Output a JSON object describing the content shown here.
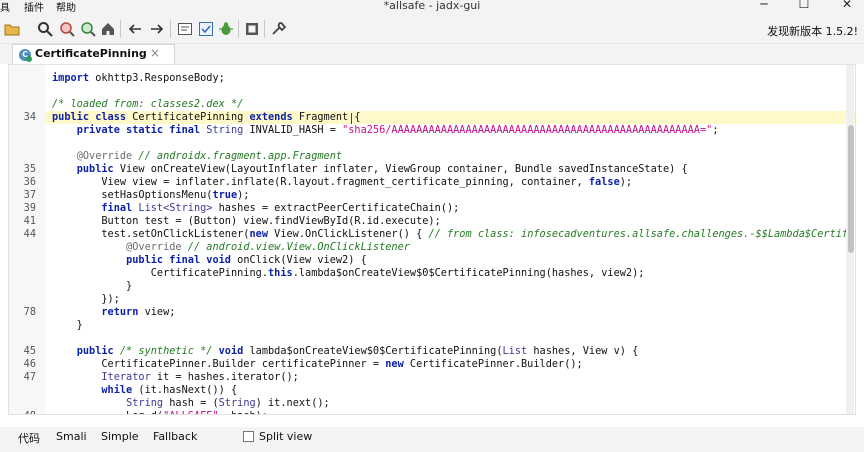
{
  "window": {
    "title": "*allsafe - jadx-gui",
    "menu": [
      "具",
      "插件",
      "帮助"
    ],
    "controls": [
      "─",
      "☐",
      "✕"
    ]
  },
  "toolbar": {
    "icons": [
      "folder-icon",
      "search-icon",
      "search-usage-icon",
      "find-icon",
      "home-icon",
      "back-icon",
      "forward-icon",
      "sync-tree-icon",
      "decompile-icon",
      "debug-icon",
      "log-icon",
      "settings-icon"
    ],
    "update_label": "发现新版本 1.5.2!"
  },
  "tab": {
    "label": "CertificatePinning",
    "icon_letter": "C",
    "close": "×"
  },
  "code_lines": [
    {
      "num": "",
      "segs": [
        {
          "t": "kw",
          "v": "import"
        },
        {
          "t": "tx",
          "v": " okhttp3.ResponseBody;"
        }
      ]
    },
    {
      "num": "",
      "segs": []
    },
    {
      "num": "",
      "segs": [
        {
          "t": "cm",
          "v": "/* loaded from: classes2.dex */"
        }
      ]
    },
    {
      "num": "34",
      "segs": [
        {
          "t": "kw",
          "v": "public class"
        },
        {
          "t": "tx",
          "v": " CertificatePinning "
        },
        {
          "t": "kw",
          "v": "extends"
        },
        {
          "t": "tx",
          "v": " Fragment {"
        }
      ]
    },
    {
      "num": "",
      "segs": [
        {
          "t": "tx",
          "v": "    "
        },
        {
          "t": "kw",
          "v": "private static final"
        },
        {
          "t": "tx",
          "v": " "
        },
        {
          "t": "ty",
          "v": "String"
        },
        {
          "t": "tx",
          "v": " INVALID_HASH = "
        },
        {
          "t": "st",
          "v": "\"sha256/AAAAAAAAAAAAAAAAAAAAAAAAAAAAAAAAAAAAAAAAAAAAAAAAAA=\""
        },
        {
          "t": "tx",
          "v": ";"
        }
      ]
    },
    {
      "num": "",
      "segs": []
    },
    {
      "num": "",
      "segs": [
        {
          "t": "tx",
          "v": "    "
        },
        {
          "t": "an",
          "v": "@Override"
        },
        {
          "t": "cm",
          "v": " // androidx.fragment.app.Fragment"
        }
      ]
    },
    {
      "num": "35",
      "segs": [
        {
          "t": "tx",
          "v": "    "
        },
        {
          "t": "kw",
          "v": "public"
        },
        {
          "t": "tx",
          "v": " View onCreateView(LayoutInflater inflater, ViewGroup container, Bundle savedInstanceState) {"
        }
      ]
    },
    {
      "num": "36",
      "segs": [
        {
          "t": "tx",
          "v": "        View view = inflater.inflate(R.layout.fragment_certificate_pinning, container, "
        },
        {
          "t": "kw",
          "v": "false"
        },
        {
          "t": "tx",
          "v": ");"
        }
      ]
    },
    {
      "num": "37",
      "segs": [
        {
          "t": "tx",
          "v": "        setHasOptionsMenu("
        },
        {
          "t": "kw",
          "v": "true"
        },
        {
          "t": "tx",
          "v": ");"
        }
      ]
    },
    {
      "num": "39",
      "segs": [
        {
          "t": "tx",
          "v": "        "
        },
        {
          "t": "kw",
          "v": "final"
        },
        {
          "t": "tx",
          "v": " "
        },
        {
          "t": "ty",
          "v": "List<String>"
        },
        {
          "t": "tx",
          "v": " hashes = extractPeerCertificateChain();"
        }
      ]
    },
    {
      "num": "41",
      "segs": [
        {
          "t": "tx",
          "v": "        Button test = (Button) view.findViewById(R.id.execute);"
        }
      ]
    },
    {
      "num": "44",
      "segs": [
        {
          "t": "tx",
          "v": "        test.setOnClickListener("
        },
        {
          "t": "kw",
          "v": "new"
        },
        {
          "t": "tx",
          "v": " View.OnClickListener() { "
        },
        {
          "t": "cm",
          "v": "// from class: infosecadventures.allsafe.challenges.-$$Lambda$CertificatePinning$"
        }
      ]
    },
    {
      "num": "",
      "segs": [
        {
          "t": "tx",
          "v": "            "
        },
        {
          "t": "an",
          "v": "@Override"
        },
        {
          "t": "cm",
          "v": " // android.view.View.OnClickListener"
        }
      ]
    },
    {
      "num": "",
      "segs": [
        {
          "t": "tx",
          "v": "            "
        },
        {
          "t": "kw",
          "v": "public final void"
        },
        {
          "t": "tx",
          "v": " onClick(View view2) {"
        }
      ]
    },
    {
      "num": "",
      "segs": [
        {
          "t": "tx",
          "v": "                CertificatePinning."
        },
        {
          "t": "kw",
          "v": "this"
        },
        {
          "t": "tx",
          "v": ".lambda$onCreateView$0$CertificatePinning(hashes, view2);"
        }
      ]
    },
    {
      "num": "",
      "segs": [
        {
          "t": "tx",
          "v": "            }"
        }
      ]
    },
    {
      "num": "",
      "segs": [
        {
          "t": "tx",
          "v": "        });"
        }
      ]
    },
    {
      "num": "78",
      "segs": [
        {
          "t": "tx",
          "v": "        "
        },
        {
          "t": "kw",
          "v": "return"
        },
        {
          "t": "tx",
          "v": " view;"
        }
      ]
    },
    {
      "num": "",
      "segs": [
        {
          "t": "tx",
          "v": "    }"
        }
      ]
    },
    {
      "num": "",
      "segs": []
    },
    {
      "num": "45",
      "segs": [
        {
          "t": "tx",
          "v": "    "
        },
        {
          "t": "kw",
          "v": "public"
        },
        {
          "t": "tx",
          "v": " "
        },
        {
          "t": "cm",
          "v": "/* synthetic */"
        },
        {
          "t": "tx",
          "v": " "
        },
        {
          "t": "kw",
          "v": "void"
        },
        {
          "t": "tx",
          "v": " lambda$onCreateView$0$CertificatePinning("
        },
        {
          "t": "ty",
          "v": "List"
        },
        {
          "t": "tx",
          "v": " hashes, View v) {"
        }
      ]
    },
    {
      "num": "46",
      "segs": [
        {
          "t": "tx",
          "v": "        CertificatePinner.Builder certificatePinner = "
        },
        {
          "t": "kw",
          "v": "new"
        },
        {
          "t": "tx",
          "v": " CertificatePinner.Builder();"
        }
      ]
    },
    {
      "num": "47",
      "segs": [
        {
          "t": "tx",
          "v": "        "
        },
        {
          "t": "ty",
          "v": "Iterator"
        },
        {
          "t": "tx",
          "v": " it = hashes.iterator();"
        }
      ]
    },
    {
      "num": "",
      "segs": [
        {
          "t": "tx",
          "v": "        "
        },
        {
          "t": "kw",
          "v": "while"
        },
        {
          "t": "tx",
          "v": " (it.hasNext()) {"
        }
      ]
    },
    {
      "num": "",
      "segs": [
        {
          "t": "tx",
          "v": "            "
        },
        {
          "t": "ty",
          "v": "String"
        },
        {
          "t": "tx",
          "v": " hash = ("
        },
        {
          "t": "ty",
          "v": "String"
        },
        {
          "t": "tx",
          "v": ") it.next();"
        }
      ]
    },
    {
      "num": "48",
      "segs": [
        {
          "t": "tx",
          "v": "            Log.d("
        },
        {
          "t": "st",
          "v": "\"ALLSAFE\""
        },
        {
          "t": "tx",
          "v": ", hash);"
        }
      ]
    }
  ],
  "bottom_tabs": [
    "代码",
    "Smali",
    "Simple",
    "Fallback"
  ],
  "split_view": {
    "label": "Split view",
    "checked": false
  },
  "colors": {
    "keyword": "#0b1fa8",
    "comment": "#247a24",
    "string": "#c10d8a",
    "current_line": "#fff9c9"
  }
}
